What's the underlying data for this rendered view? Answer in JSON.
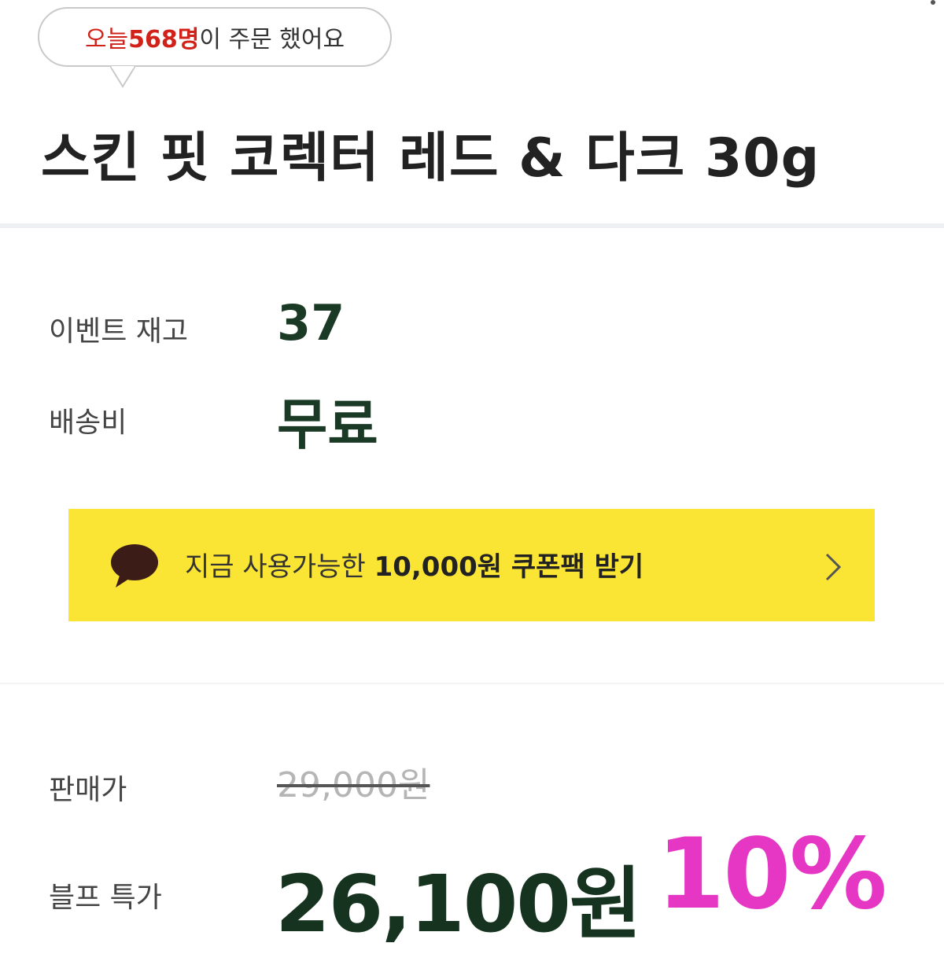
{
  "order_bubble": {
    "prefix": "오늘 ",
    "count": "568명",
    "suffix": "이 주문 했어요"
  },
  "product": {
    "title": "스킨 핏 코렉터 레드 & 다크 30g"
  },
  "event_stock": {
    "label": "이벤트 재고",
    "value": "37"
  },
  "shipping": {
    "label": "배송비",
    "value": "무료"
  },
  "coupon_banner": {
    "text_prefix": "지금 사용가능한 ",
    "text_strong": "10,000원 쿠폰팩 받기",
    "chat_icon": "speech-bubble-icon",
    "arrow_icon": "chevron-right-icon",
    "background": "#fae534"
  },
  "price": {
    "label": "판매가",
    "original": "29,000원",
    "sale_label": "블프 특가",
    "sale": "26,100원",
    "discount": "10%"
  },
  "colors": {
    "accent_red": "#d1221a",
    "price_green": "#16331f",
    "discount_pink": "#e536c4"
  }
}
